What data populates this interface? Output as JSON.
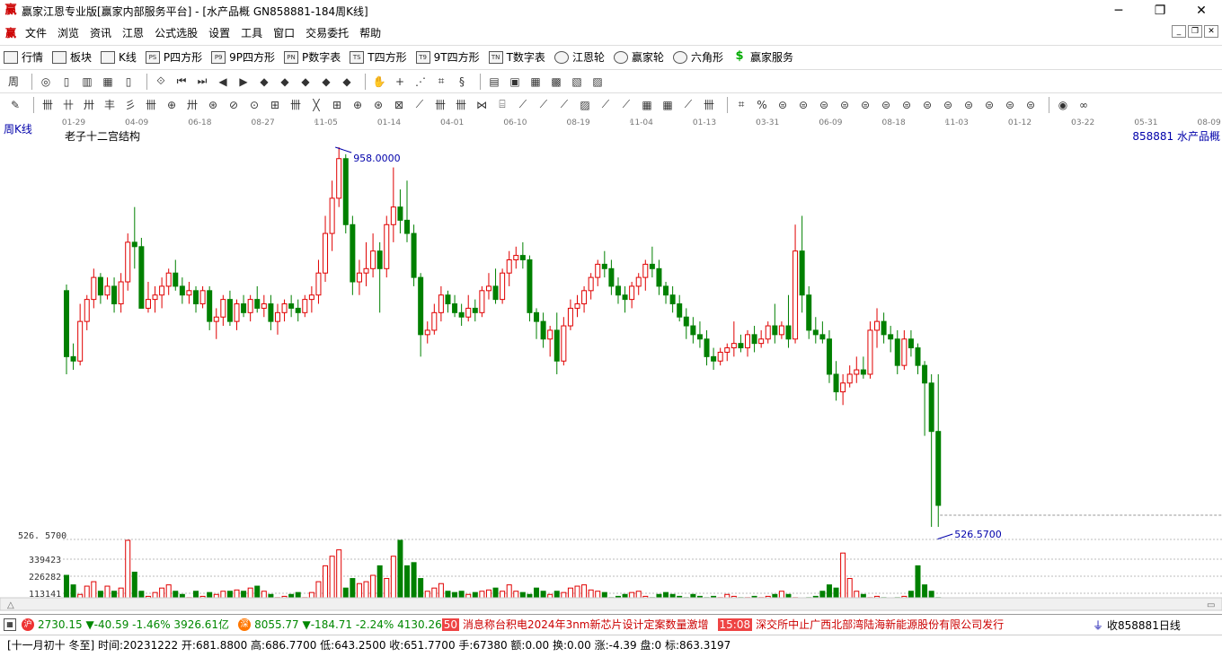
{
  "window": {
    "title": "赢家江恩专业版[赢家内部服务平台] - [水产品概  GN858881-184周K线]",
    "logo": "赢"
  },
  "menu": {
    "logo": "赢",
    "items": [
      "文件",
      "浏览",
      "资讯",
      "江恩",
      "公式选股",
      "设置",
      "工具",
      "窗口",
      "交易委托",
      "帮助"
    ]
  },
  "toolbar_main": [
    {
      "label": "行情",
      "icon": "grid-icon"
    },
    {
      "label": "板块",
      "icon": "blocks-icon"
    },
    {
      "label": "K线",
      "icon": "kline-icon"
    },
    {
      "label": "P四方形",
      "icon": "ps-icon",
      "tag": "PS"
    },
    {
      "label": "9P四方形",
      "icon": "p9-icon",
      "tag": "P9"
    },
    {
      "label": "P数字表",
      "icon": "pn-icon",
      "tag": "PN"
    },
    {
      "label": "T四方形",
      "icon": "ts-icon",
      "tag": "TS"
    },
    {
      "label": "9T四方形",
      "icon": "t9-icon",
      "tag": "T9"
    },
    {
      "label": "T数字表",
      "icon": "tn-icon",
      "tag": "TN"
    },
    {
      "label": "江恩轮",
      "icon": "wheel-icon"
    },
    {
      "label": "赢家轮",
      "icon": "wheel2-icon"
    },
    {
      "label": "六角形",
      "icon": "hexagon-icon"
    },
    {
      "label": "赢家服务",
      "icon": "dollar-icon"
    }
  ],
  "toolbar2_glyphs": [
    "周",
    "◎",
    "▯",
    "▥",
    "▦",
    "▯",
    "⟐",
    "⏮",
    "⏭",
    "◀",
    "▶",
    "◆",
    "◆",
    "◆",
    "◆",
    "◆",
    "✋",
    "+",
    "⋰",
    "⌗",
    "§",
    "▤",
    "▣",
    "▦",
    "▩",
    "▧",
    "▨"
  ],
  "toolbar3_glyphs": [
    "✎",
    "卌",
    "卄",
    "卅",
    "丰",
    "彡",
    "卌",
    "⊕",
    "卅",
    "⊛",
    "⊘",
    "⊙",
    "⊞",
    "卌",
    "╳",
    "⊞",
    "⊕",
    "⊛",
    "⊠",
    "⟋",
    "卌",
    "卌",
    "⋈",
    "⌸",
    "⟋",
    "⟋",
    "⟋",
    "▨",
    "⟋",
    "⟋",
    "▦",
    "▦",
    "⟋",
    "卌",
    "⌗",
    "%",
    "⊜",
    "⊜",
    "⊜",
    "⊜",
    "⊜",
    "⊜",
    "⊜",
    "⊜",
    "⊜",
    "⊜",
    "⊜",
    "⊜",
    "⊜",
    "◉",
    "∞"
  ],
  "chart": {
    "period": "周K线",
    "formula": "老子十二宫结构",
    "stock": "858881  水产品概",
    "colors": {
      "up": "#e00000",
      "down": "#008000",
      "axis_text": "#777777",
      "label_blue": "#0000aa"
    },
    "date_ticks": [
      "01-29",
      "04-09",
      "06-18",
      "08-27",
      "11-05",
      "01-14",
      "04-01",
      "06-10",
      "08-19",
      "11-04",
      "01-13",
      "03-31",
      "06-09",
      "08-18",
      "11-03",
      "01-12",
      "03-22",
      "05-31",
      "08-09"
    ],
    "high_label": "958.0000",
    "low_label": "526.5700",
    "low_axis_label": "526. 5700",
    "volume_ticks": [
      "339423",
      "226282",
      "113141"
    ]
  },
  "chart_data": {
    "type": "candlestick",
    "price_range": [
      526.57,
      958.0
    ],
    "candles": [
      {
        "o": 795,
        "h": 802,
        "l": 700,
        "c": 720
      },
      {
        "o": 720,
        "h": 735,
        "l": 705,
        "c": 715
      },
      {
        "o": 715,
        "h": 780,
        "l": 710,
        "c": 760
      },
      {
        "o": 760,
        "h": 790,
        "l": 750,
        "c": 785
      },
      {
        "o": 785,
        "h": 820,
        "l": 775,
        "c": 810
      },
      {
        "o": 810,
        "h": 815,
        "l": 780,
        "c": 790
      },
      {
        "o": 790,
        "h": 810,
        "l": 785,
        "c": 800
      },
      {
        "o": 800,
        "h": 810,
        "l": 770,
        "c": 780
      },
      {
        "o": 780,
        "h": 815,
        "l": 770,
        "c": 805
      },
      {
        "o": 805,
        "h": 860,
        "l": 795,
        "c": 850
      },
      {
        "o": 850,
        "h": 890,
        "l": 820,
        "c": 845
      },
      {
        "o": 845,
        "h": 855,
        "l": 800,
        "c": 775
      },
      {
        "o": 775,
        "h": 805,
        "l": 770,
        "c": 785
      },
      {
        "o": 785,
        "h": 800,
        "l": 770,
        "c": 790
      },
      {
        "o": 790,
        "h": 810,
        "l": 775,
        "c": 800
      },
      {
        "o": 800,
        "h": 820,
        "l": 790,
        "c": 815
      },
      {
        "o": 815,
        "h": 830,
        "l": 795,
        "c": 800
      },
      {
        "o": 800,
        "h": 810,
        "l": 780,
        "c": 790
      },
      {
        "o": 790,
        "h": 805,
        "l": 780,
        "c": 795
      },
      {
        "o": 795,
        "h": 800,
        "l": 770,
        "c": 780
      },
      {
        "o": 780,
        "h": 800,
        "l": 775,
        "c": 795
      },
      {
        "o": 795,
        "h": 800,
        "l": 750,
        "c": 760
      },
      {
        "o": 760,
        "h": 775,
        "l": 740,
        "c": 765
      },
      {
        "o": 765,
        "h": 790,
        "l": 755,
        "c": 785
      },
      {
        "o": 785,
        "h": 795,
        "l": 755,
        "c": 760
      },
      {
        "o": 760,
        "h": 785,
        "l": 750,
        "c": 780
      },
      {
        "o": 780,
        "h": 790,
        "l": 765,
        "c": 770
      },
      {
        "o": 770,
        "h": 790,
        "l": 760,
        "c": 785
      },
      {
        "o": 785,
        "h": 800,
        "l": 770,
        "c": 775
      },
      {
        "o": 775,
        "h": 790,
        "l": 765,
        "c": 780
      },
      {
        "o": 780,
        "h": 790,
        "l": 750,
        "c": 760
      },
      {
        "o": 760,
        "h": 780,
        "l": 745,
        "c": 770
      },
      {
        "o": 770,
        "h": 785,
        "l": 760,
        "c": 780
      },
      {
        "o": 780,
        "h": 790,
        "l": 765,
        "c": 775
      },
      {
        "o": 775,
        "h": 785,
        "l": 760,
        "c": 770
      },
      {
        "o": 770,
        "h": 790,
        "l": 765,
        "c": 785
      },
      {
        "o": 785,
        "h": 800,
        "l": 770,
        "c": 790
      },
      {
        "o": 790,
        "h": 830,
        "l": 780,
        "c": 815
      },
      {
        "o": 815,
        "h": 880,
        "l": 805,
        "c": 860
      },
      {
        "o": 860,
        "h": 920,
        "l": 840,
        "c": 900
      },
      {
        "o": 900,
        "h": 958,
        "l": 890,
        "c": 945
      },
      {
        "o": 945,
        "h": 950,
        "l": 860,
        "c": 870
      },
      {
        "o": 870,
        "h": 880,
        "l": 790,
        "c": 805
      },
      {
        "o": 805,
        "h": 830,
        "l": 790,
        "c": 815
      },
      {
        "o": 815,
        "h": 850,
        "l": 800,
        "c": 820
      },
      {
        "o": 820,
        "h": 860,
        "l": 810,
        "c": 840
      },
      {
        "o": 840,
        "h": 850,
        "l": 770,
        "c": 820
      },
      {
        "o": 820,
        "h": 880,
        "l": 810,
        "c": 870
      },
      {
        "o": 870,
        "h": 935,
        "l": 850,
        "c": 890
      },
      {
        "o": 890,
        "h": 910,
        "l": 860,
        "c": 875
      },
      {
        "o": 875,
        "h": 920,
        "l": 850,
        "c": 860
      },
      {
        "o": 860,
        "h": 870,
        "l": 800,
        "c": 810
      },
      {
        "o": 810,
        "h": 815,
        "l": 720,
        "c": 745
      },
      {
        "o": 745,
        "h": 760,
        "l": 735,
        "c": 750
      },
      {
        "o": 750,
        "h": 780,
        "l": 745,
        "c": 770
      },
      {
        "o": 770,
        "h": 800,
        "l": 760,
        "c": 790
      },
      {
        "o": 790,
        "h": 795,
        "l": 770,
        "c": 780
      },
      {
        "o": 780,
        "h": 790,
        "l": 765,
        "c": 770
      },
      {
        "o": 770,
        "h": 780,
        "l": 755,
        "c": 765
      },
      {
        "o": 765,
        "h": 790,
        "l": 760,
        "c": 775
      },
      {
        "o": 775,
        "h": 785,
        "l": 760,
        "c": 770
      },
      {
        "o": 770,
        "h": 800,
        "l": 765,
        "c": 795
      },
      {
        "o": 795,
        "h": 815,
        "l": 785,
        "c": 800
      },
      {
        "o": 800,
        "h": 820,
        "l": 780,
        "c": 785
      },
      {
        "o": 785,
        "h": 820,
        "l": 780,
        "c": 815
      },
      {
        "o": 815,
        "h": 840,
        "l": 800,
        "c": 830
      },
      {
        "o": 830,
        "h": 845,
        "l": 820,
        "c": 835
      },
      {
        "o": 835,
        "h": 850,
        "l": 820,
        "c": 830
      },
      {
        "o": 830,
        "h": 835,
        "l": 760,
        "c": 770
      },
      {
        "o": 770,
        "h": 775,
        "l": 740,
        "c": 760
      },
      {
        "o": 760,
        "h": 770,
        "l": 730,
        "c": 740
      },
      {
        "o": 740,
        "h": 755,
        "l": 720,
        "c": 750
      },
      {
        "o": 750,
        "h": 770,
        "l": 700,
        "c": 715
      },
      {
        "o": 715,
        "h": 765,
        "l": 710,
        "c": 755
      },
      {
        "o": 755,
        "h": 785,
        "l": 750,
        "c": 775
      },
      {
        "o": 775,
        "h": 790,
        "l": 765,
        "c": 780
      },
      {
        "o": 780,
        "h": 800,
        "l": 770,
        "c": 795
      },
      {
        "o": 795,
        "h": 815,
        "l": 785,
        "c": 810
      },
      {
        "o": 810,
        "h": 830,
        "l": 800,
        "c": 825
      },
      {
        "o": 825,
        "h": 840,
        "l": 810,
        "c": 820
      },
      {
        "o": 820,
        "h": 830,
        "l": 790,
        "c": 800
      },
      {
        "o": 800,
        "h": 810,
        "l": 780,
        "c": 790
      },
      {
        "o": 790,
        "h": 800,
        "l": 770,
        "c": 785
      },
      {
        "o": 785,
        "h": 805,
        "l": 775,
        "c": 800
      },
      {
        "o": 800,
        "h": 815,
        "l": 790,
        "c": 810
      },
      {
        "o": 810,
        "h": 830,
        "l": 795,
        "c": 825
      },
      {
        "o": 825,
        "h": 845,
        "l": 810,
        "c": 820
      },
      {
        "o": 820,
        "h": 830,
        "l": 790,
        "c": 800
      },
      {
        "o": 800,
        "h": 805,
        "l": 780,
        "c": 790
      },
      {
        "o": 790,
        "h": 800,
        "l": 770,
        "c": 780
      },
      {
        "o": 780,
        "h": 790,
        "l": 760,
        "c": 765
      },
      {
        "o": 765,
        "h": 775,
        "l": 740,
        "c": 755
      },
      {
        "o": 755,
        "h": 765,
        "l": 735,
        "c": 745
      },
      {
        "o": 745,
        "h": 760,
        "l": 730,
        "c": 740
      },
      {
        "o": 740,
        "h": 750,
        "l": 710,
        "c": 720
      },
      {
        "o": 720,
        "h": 730,
        "l": 705,
        "c": 715
      },
      {
        "o": 715,
        "h": 730,
        "l": 710,
        "c": 725
      },
      {
        "o": 725,
        "h": 735,
        "l": 715,
        "c": 730
      },
      {
        "o": 730,
        "h": 760,
        "l": 720,
        "c": 735
      },
      {
        "o": 735,
        "h": 745,
        "l": 725,
        "c": 730
      },
      {
        "o": 730,
        "h": 750,
        "l": 720,
        "c": 745
      },
      {
        "o": 745,
        "h": 755,
        "l": 725,
        "c": 735
      },
      {
        "o": 735,
        "h": 750,
        "l": 730,
        "c": 740
      },
      {
        "o": 740,
        "h": 760,
        "l": 735,
        "c": 755
      },
      {
        "o": 755,
        "h": 780,
        "l": 735,
        "c": 745
      },
      {
        "o": 745,
        "h": 760,
        "l": 740,
        "c": 755
      },
      {
        "o": 755,
        "h": 790,
        "l": 730,
        "c": 740
      },
      {
        "o": 740,
        "h": 870,
        "l": 735,
        "c": 840
      },
      {
        "o": 840,
        "h": 880,
        "l": 770,
        "c": 790
      },
      {
        "o": 790,
        "h": 800,
        "l": 740,
        "c": 750
      },
      {
        "o": 750,
        "h": 765,
        "l": 735,
        "c": 745
      },
      {
        "o": 745,
        "h": 760,
        "l": 735,
        "c": 740
      },
      {
        "o": 740,
        "h": 750,
        "l": 690,
        "c": 700
      },
      {
        "o": 700,
        "h": 715,
        "l": 670,
        "c": 680
      },
      {
        "o": 680,
        "h": 700,
        "l": 665,
        "c": 690
      },
      {
        "o": 690,
        "h": 710,
        "l": 685,
        "c": 700
      },
      {
        "o": 700,
        "h": 720,
        "l": 690,
        "c": 705
      },
      {
        "o": 705,
        "h": 720,
        "l": 695,
        "c": 700
      },
      {
        "o": 700,
        "h": 760,
        "l": 695,
        "c": 750
      },
      {
        "o": 750,
        "h": 775,
        "l": 730,
        "c": 760
      },
      {
        "o": 760,
        "h": 770,
        "l": 735,
        "c": 745
      },
      {
        "o": 745,
        "h": 755,
        "l": 725,
        "c": 740
      },
      {
        "o": 740,
        "h": 750,
        "l": 700,
        "c": 710
      },
      {
        "o": 710,
        "h": 750,
        "l": 705,
        "c": 740
      },
      {
        "o": 740,
        "h": 750,
        "l": 720,
        "c": 730
      },
      {
        "o": 730,
        "h": 735,
        "l": 700,
        "c": 710
      },
      {
        "o": 710,
        "h": 715,
        "l": 630,
        "c": 690
      },
      {
        "o": 690,
        "h": 700,
        "l": 526.57,
        "c": 635
      },
      {
        "o": 635,
        "h": 700,
        "l": 526.57,
        "c": 551
      }
    ],
    "volumes": [
      55,
      40,
      25,
      38,
      45,
      30,
      38,
      30,
      35,
      110,
      60,
      30,
      22,
      28,
      35,
      40,
      30,
      25,
      20,
      30,
      22,
      28,
      25,
      30,
      30,
      32,
      30,
      35,
      38,
      30,
      25,
      20,
      22,
      25,
      28,
      20,
      28,
      45,
      70,
      85,
      95,
      35,
      50,
      42,
      45,
      55,
      70,
      50,
      85,
      110,
      70,
      75,
      50,
      30,
      35,
      42,
      30,
      28,
      30,
      25,
      28,
      30,
      32,
      35,
      30,
      40,
      30,
      28,
      25,
      35,
      30,
      25,
      30,
      28,
      35,
      38,
      40,
      32,
      30,
      28,
      20,
      22,
      25,
      28,
      30,
      22,
      20,
      25,
      28,
      25,
      22,
      20,
      25,
      22,
      20,
      22,
      20,
      25,
      22,
      20,
      20,
      22,
      20,
      22,
      25,
      30,
      25,
      20,
      18,
      20,
      22,
      30,
      40,
      35,
      90,
      50,
      30,
      25,
      20,
      22,
      20,
      18,
      20,
      22,
      30,
      70,
      40,
      30,
      20,
      18,
      15,
      20,
      22,
      25,
      18
    ]
  },
  "status1": {
    "idx1_badge": "沪",
    "idx1": "2730.15 ▼-40.59 -1.46% 3926.61亿",
    "idx2_badge": "深",
    "idx2": "8055.77 ▼-184.71 -2.24% 4130.26",
    "news_cut": "50",
    "news1": "消息称台积电2024年3nm新芯片设计定案数量激增",
    "news_time": "15:08",
    "news2": "深交所中止广西北部湾陆海新能源股份有限公司发行",
    "right_text": "收858881日线"
  },
  "status2": {
    "text": "[十一月初十 冬至] 时间:20231222 开:681.8800 高:686.7700 低:643.2500 收:651.7700 手:67380 额:0.00 换:0.00 涨:-4.39 盘:0 标:863.3197"
  }
}
